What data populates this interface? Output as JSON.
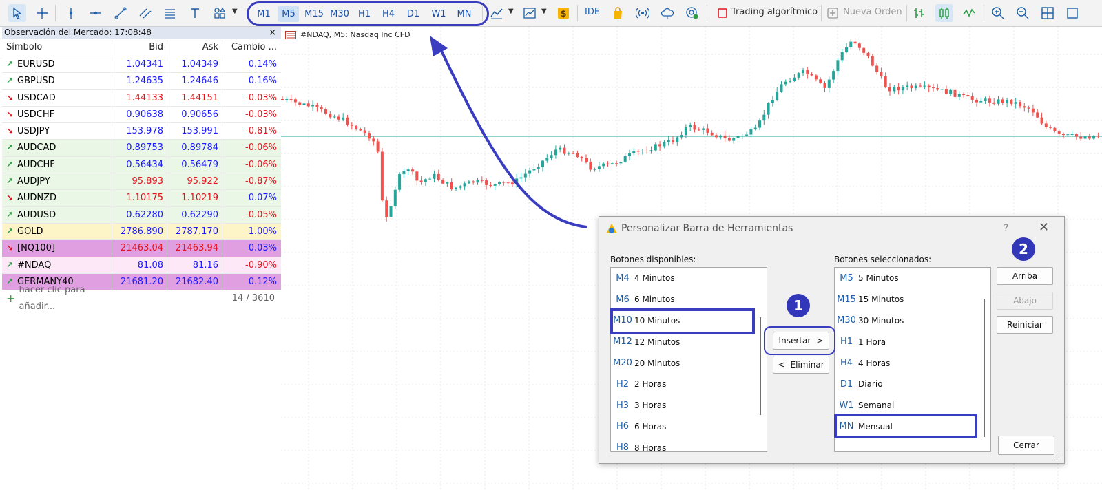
{
  "toolbar": {
    "timeframes": [
      "M1",
      "M5",
      "M15",
      "M30",
      "H1",
      "H4",
      "D1",
      "W1",
      "MN"
    ],
    "active_timeframe": "M5",
    "ide_label": "IDE",
    "algo_label": "Trading algorítmico",
    "new_order_label": "Nueva Orden"
  },
  "market_watch": {
    "title": "Observación del Mercado: 17:08:48",
    "close": "×",
    "headers": {
      "symbol": "Símbolo",
      "bid": "Bid",
      "ask": "Ask",
      "change": "Cambio ..."
    },
    "rows": [
      {
        "dir": "up",
        "symbol": "EURUSD",
        "bid": "1.04341",
        "ask": "1.04349",
        "change": "0.14%",
        "color": "#1a1aff",
        "bg": "#ffffff"
      },
      {
        "dir": "up",
        "symbol": "GBPUSD",
        "bid": "1.24635",
        "ask": "1.24646",
        "change": "0.16%",
        "color": "#1a1aff",
        "bg": "#ffffff"
      },
      {
        "dir": "down",
        "symbol": "USDCAD",
        "bid": "1.44133",
        "ask": "1.44151",
        "change": "-0.03%",
        "color": "#e3121b",
        "bg": "#ffffff"
      },
      {
        "dir": "down",
        "symbol": "USDCHF",
        "bid": "0.90638",
        "ask": "0.90656",
        "change": "-0.03%",
        "color": "#1a1aff",
        "bg": "#ffffff"
      },
      {
        "dir": "down",
        "symbol": "USDJPY",
        "bid": "153.978",
        "ask": "153.991",
        "change": "-0.81%",
        "color": "#1a1aff",
        "bg": "#ffffff"
      },
      {
        "dir": "up",
        "symbol": "AUDCAD",
        "bid": "0.89753",
        "ask": "0.89784",
        "change": "-0.06%",
        "color": "#1a1aff",
        "bg": "#eaf6e6"
      },
      {
        "dir": "up",
        "symbol": "AUDCHF",
        "bid": "0.56434",
        "ask": "0.56479",
        "change": "-0.06%",
        "color": "#1a1aff",
        "bg": "#eaf6e6"
      },
      {
        "dir": "up",
        "symbol": "AUDJPY",
        "bid": "95.893",
        "ask": "95.922",
        "change": "-0.87%",
        "color": "#e3121b",
        "bg": "#eaf6e6"
      },
      {
        "dir": "down",
        "symbol": "AUDNZD",
        "bid": "1.10175",
        "ask": "1.10219",
        "change": "0.07%",
        "color": "#e3121b",
        "bg": "#eaf6e6"
      },
      {
        "dir": "up",
        "symbol": "AUDUSD",
        "bid": "0.62280",
        "ask": "0.62290",
        "change": "-0.05%",
        "color": "#1a1aff",
        "bg": "#eaf6e6"
      },
      {
        "dir": "up",
        "symbol": "GOLD",
        "bid": "2786.890",
        "ask": "2787.170",
        "change": "1.00%",
        "color": "#1a1aff",
        "bg": "#fdf5c8"
      },
      {
        "dir": "down",
        "symbol": "[NQ100]",
        "bid": "21463.04",
        "ask": "21463.94",
        "change": "0.03%",
        "color": "#e3121b",
        "bg": "#df9fe0"
      },
      {
        "dir": "up",
        "symbol": "#NDAQ",
        "bid": "81.08",
        "ask": "81.16",
        "change": "-0.90%",
        "color": "#1a1aff",
        "bg": "#fce8f6"
      },
      {
        "dir": "up",
        "symbol": "GERMANY40",
        "bid": "21681.20",
        "ask": "21682.40",
        "change": "0.12%",
        "color": "#1a1aff",
        "bg": "#df9fe0"
      }
    ],
    "add_label": "hacer clic para añadir...",
    "count": "14 / 3610"
  },
  "chart": {
    "label": "#NDAQ, M5:  Nasdaq Inc CFD"
  },
  "dialog": {
    "title": "Personalizar Barra de Herramientas",
    "help": "?",
    "close": "✕",
    "available_label": "Botones disponibles:",
    "selected_label": "Botones seleccionados:",
    "available": [
      {
        "code": "M4",
        "name": "4 Minutos"
      },
      {
        "code": "M6",
        "name": "6 Minutos"
      },
      {
        "code": "M10",
        "name": "10 Minutos"
      },
      {
        "code": "M12",
        "name": "12 Minutos"
      },
      {
        "code": "M20",
        "name": "20 Minutos"
      },
      {
        "code": "H2",
        "name": "2 Horas"
      },
      {
        "code": "H3",
        "name": "3 Horas"
      },
      {
        "code": "H6",
        "name": "6 Horas"
      },
      {
        "code": "H8",
        "name": "8 Horas"
      }
    ],
    "selected": [
      {
        "code": "M5",
        "name": "5 Minutos"
      },
      {
        "code": "M15",
        "name": "15 Minutos"
      },
      {
        "code": "M30",
        "name": "30 Minutos"
      },
      {
        "code": "H1",
        "name": "1 Hora"
      },
      {
        "code": "H4",
        "name": "4 Horas"
      },
      {
        "code": "D1",
        "name": "Diario"
      },
      {
        "code": "W1",
        "name": "Semanal"
      },
      {
        "code": "MN",
        "name": "Mensual"
      }
    ],
    "insert_label": "Insertar ->",
    "remove_label": "<- Eliminar",
    "up_label": "Arriba",
    "down_label": "Abajo",
    "reset_label": "Reiniciar",
    "close_label": "Cerrar"
  },
  "annotations": {
    "badge1": "1",
    "badge2": "2"
  },
  "colors": {
    "accent": "#3a3dbf",
    "bid_up": "#1a1aff",
    "down": "#e3121b",
    "bull": "#26a69a",
    "bear": "#ef5350"
  }
}
